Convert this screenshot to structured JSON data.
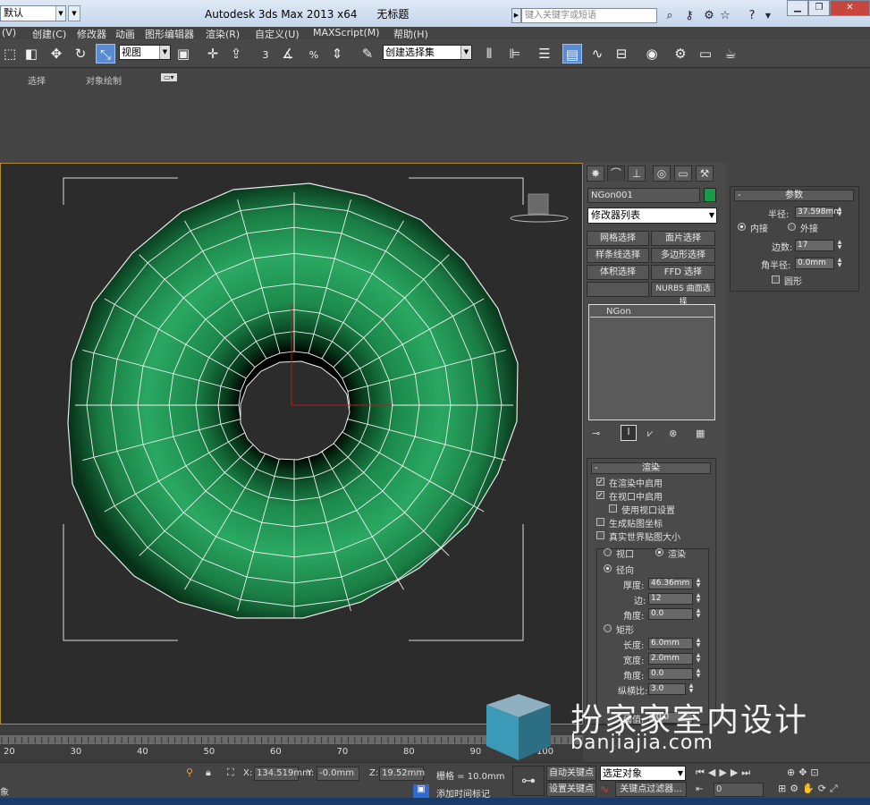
{
  "window": {
    "workspace": "默认",
    "title_app": "Autodesk 3ds Max  2013 x64",
    "title_doc": "无标题",
    "search_placeholder": "键入关键字或短语"
  },
  "menu": [
    "(V)",
    "创建(C)",
    "修改器",
    "动画",
    "图形编辑器",
    "渲染(R)",
    "自定义(U)",
    "MAXScript(M)",
    "帮助(H)"
  ],
  "toolbar": {
    "ref_coord": "视图",
    "selection_set": "创建选择集",
    "snap_labels": [
      "3",
      "%"
    ]
  },
  "ribbon": {
    "tabs": [
      "选择",
      "对象绘制"
    ]
  },
  "command_panel": {
    "object_name": "NGon001",
    "object_color": "#1a9a48",
    "modifier_list": "修改器列表",
    "selection_buttons": [
      "网格选择",
      "面片选择",
      "样条线选择",
      "多边形选择",
      "体积选择",
      "FFD 选择",
      "",
      "NURBS 曲面选择"
    ],
    "stack_items": [
      "NGon"
    ]
  },
  "params": {
    "title": "参数",
    "radius_label": "半径:",
    "radius": "37.598mm",
    "inscribed": "内接",
    "circumscribed": "外接",
    "sides_label": "边数:",
    "sides": "17",
    "corner_label": "角半径:",
    "corner": "0.0mm",
    "circular": "圆形"
  },
  "render": {
    "title": "渲染",
    "enable_render": "在渲染中启用",
    "enable_viewport": "在视口中启用",
    "use_viewport": "使用视口设置",
    "gen_mapping": "生成贴图坐标",
    "real_world": "真实世界贴图大小",
    "viewport": "视口",
    "renderer": "渲染",
    "radial": "径向",
    "thickness_label": "厚度:",
    "thickness": "46.36mm",
    "sides_label": "边:",
    "sides": "12",
    "angle_label": "角度:",
    "angle": "0.0",
    "rect": "矩形",
    "length_label": "长度:",
    "length": "6.0mm",
    "width_label": "宽度:",
    "width": "2.0mm",
    "angle2": "0.0",
    "aspect_label": "纵横比:",
    "aspect": "3.0",
    "threshold_label": "阈值:",
    "threshold": "40.0"
  },
  "timeline": {
    "ticks": [
      "20",
      "30",
      "40",
      "50",
      "60",
      "70",
      "80",
      "90",
      "100"
    ]
  },
  "status": {
    "x_label": "X:",
    "x": "134.519mm",
    "y_label": "Y:",
    "y": "-0.0mm",
    "z_label": "Z:",
    "z": "19.52mm",
    "grid": "栅格 = 10.0mm",
    "auto_key": "自动关键点",
    "selected": "选定对象",
    "set_key": "设置关键点",
    "key_filters": "关键点过滤器...",
    "add_time_tag": "添加时间标记",
    "frame": "0",
    "left_status": "象"
  },
  "watermark": {
    "cn": "扮家家室内设计",
    "url": "banjiajia.com"
  }
}
